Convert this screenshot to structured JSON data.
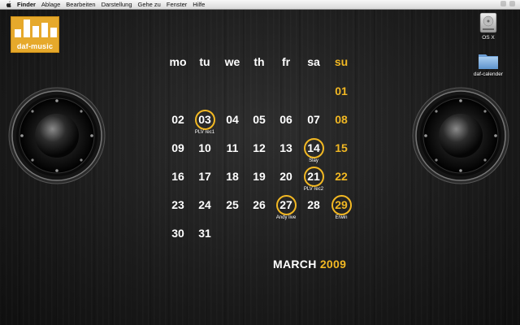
{
  "menubar": {
    "items": [
      "Finder",
      "Ablage",
      "Bearbeiten",
      "Darstellung",
      "Gehe zu",
      "Fenster",
      "Hilfe"
    ]
  },
  "logo": {
    "text": "daf-music"
  },
  "desktop": {
    "icons": [
      {
        "label": "OS X",
        "type": "hard-drive"
      },
      {
        "label": "daf-calender",
        "type": "folder"
      }
    ]
  },
  "calendar": {
    "weekdays": [
      "mo",
      "tu",
      "we",
      "th",
      "fr",
      "sa",
      "su"
    ],
    "month": "MARCH",
    "year": "2009",
    "weeks": [
      [
        "",
        "",
        "",
        "",
        "",
        "",
        "01"
      ],
      [
        "02",
        "03",
        "04",
        "05",
        "06",
        "07",
        "08"
      ],
      [
        "09",
        "10",
        "11",
        "12",
        "13",
        "14",
        "15"
      ],
      [
        "16",
        "17",
        "18",
        "19",
        "20",
        "21",
        "22"
      ],
      [
        "23",
        "24",
        "25",
        "26",
        "27",
        "28",
        "29"
      ],
      [
        "30",
        "31",
        "",
        "",
        "",
        "",
        ""
      ]
    ],
    "events": [
      {
        "day": "03",
        "label": "PLV rec1"
      },
      {
        "day": "14",
        "label": "Slay"
      },
      {
        "day": "21",
        "label": "PLV rec2"
      },
      {
        "day": "27",
        "label": "Andy live"
      },
      {
        "day": "29",
        "label": "Erwin"
      }
    ]
  },
  "colors": {
    "accent": "#f2b823",
    "text": "#ffffff",
    "background": "#1c1c1c"
  }
}
